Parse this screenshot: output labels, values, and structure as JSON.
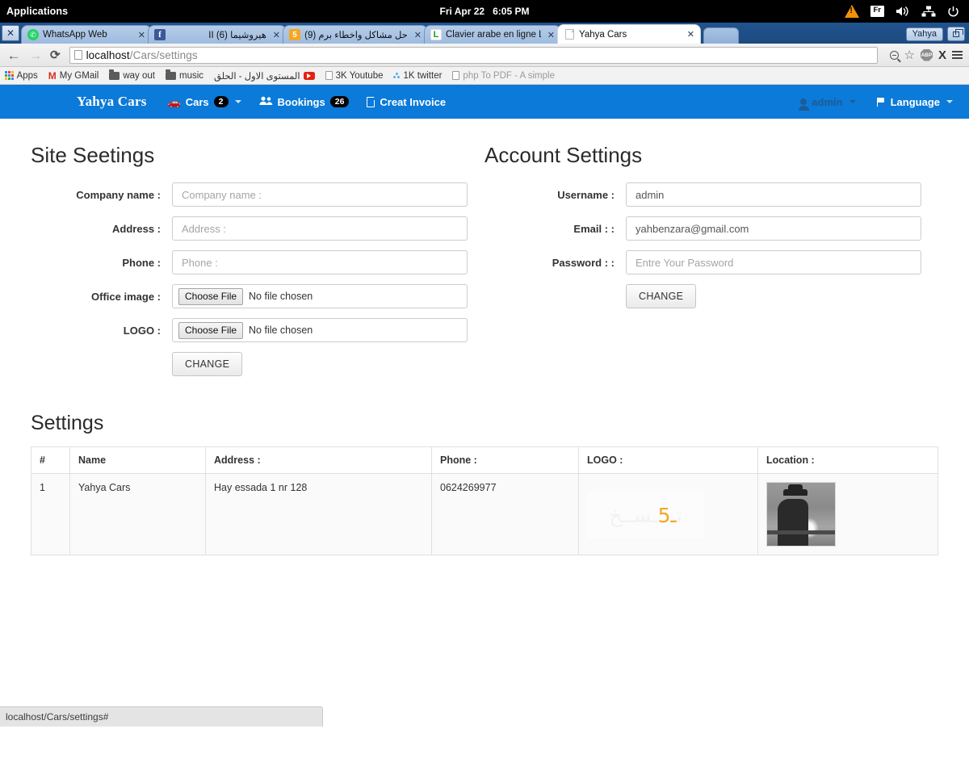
{
  "os": {
    "applications_label": "Applications",
    "clock_date": "Fri Apr 22",
    "clock_time": "6:05 PM",
    "tray": {
      "warning_icon": "warning-triangle-icon",
      "keyboard_layout": "Fr",
      "volume_icon": "speaker-icon",
      "network_icon": "network-icon",
      "power_icon": "power-icon"
    }
  },
  "browser": {
    "tabs": [
      {
        "title": "WhatsApp Web",
        "favicon": "whatsapp-icon",
        "rtl": false,
        "active": false
      },
      {
        "title": "هيروشيما II (6)",
        "favicon": "facebook-icon",
        "rtl": true,
        "active": false
      },
      {
        "title": "حل مشاكل واخطاء برم (9)",
        "favicon": "number-5-icon",
        "rtl": true,
        "active": false
      },
      {
        "title": "Clavier arabe en ligne LEX",
        "favicon": "lexilogos-icon",
        "rtl": false,
        "active": false
      },
      {
        "title": "Yahya Cars",
        "favicon": "page-icon",
        "rtl": false,
        "active": true
      }
    ],
    "window_close_label": "✕",
    "user_pill": "Yahya",
    "toolbar": {
      "back_icon": "back-arrow-icon",
      "forward_icon": "forward-arrow-icon",
      "reload_icon": "reload-icon",
      "url_host": "localhost",
      "url_path": "/Cars/settings",
      "zoom_out_icon": "zoom-out-icon",
      "bookmark_star_icon": "star-icon",
      "adblock_label": "ABP",
      "extension_x_label": "X",
      "menu_icon": "hamburger-menu-icon"
    },
    "bookmarks": [
      {
        "label": "Apps",
        "icon": "apps-grid-icon",
        "faded": false,
        "rtl": false
      },
      {
        "label": "My GMail",
        "icon": "gmail-icon",
        "faded": false,
        "rtl": false
      },
      {
        "label": "way out",
        "icon": "folder-icon",
        "faded": false,
        "rtl": false
      },
      {
        "label": "music",
        "icon": "folder-icon",
        "faded": false,
        "rtl": false
      },
      {
        "label": "المستوى الاول - الحلق",
        "icon": "youtube-icon",
        "faded": false,
        "rtl": true
      },
      {
        "label": "3K Youtube",
        "icon": "page-icon",
        "faded": false,
        "rtl": false
      },
      {
        "label": "1K twitter",
        "icon": "twitter-icon",
        "faded": false,
        "rtl": false
      },
      {
        "label": "php To PDF - A simple",
        "icon": "page-icon",
        "faded": true,
        "rtl": false
      }
    ],
    "status_bar_text": "localhost/Cars/settings#"
  },
  "app": {
    "navbar": {
      "brand": "Yahya Cars",
      "items": [
        {
          "label": "Cars",
          "badge": "2",
          "icon": "car-icon",
          "caret": true
        },
        {
          "label": "Bookings",
          "badge": "26",
          "icon": "users-icon",
          "caret": false
        },
        {
          "label": "Creat Invoice",
          "badge": "",
          "icon": "document-icon",
          "caret": false
        }
      ],
      "right_items": [
        {
          "label": "admin",
          "icon": "person-icon",
          "caret": true
        },
        {
          "label": "Language",
          "icon": "flag-icon",
          "caret": true
        }
      ],
      "background_color": "#0b7ad8"
    },
    "site_settings": {
      "title": "Site Seetings",
      "fields": [
        {
          "label": "Company name :",
          "type": "text",
          "value": "",
          "placeholder": "Company name :"
        },
        {
          "label": "Address :",
          "type": "text",
          "value": "",
          "placeholder": "Address :"
        },
        {
          "label": "Phone :",
          "type": "text",
          "value": "",
          "placeholder": "Phone :"
        },
        {
          "label": "Office image :",
          "type": "file",
          "button": "Choose File",
          "status": "No file chosen"
        },
        {
          "label": "LOGO :",
          "type": "file",
          "button": "Choose File",
          "status": "No file chosen"
        }
      ],
      "submit_label": "CHANGE"
    },
    "account_settings": {
      "title": "Account Settings",
      "fields": [
        {
          "label": "Username :",
          "type": "text",
          "value": "admin",
          "placeholder": ""
        },
        {
          "label": "Email : :",
          "type": "text",
          "value": "yahbenzara@gmail.com",
          "placeholder": ""
        },
        {
          "label": "Password : :",
          "type": "password",
          "value": "",
          "placeholder": "Entre Your Password"
        }
      ],
      "submit_label": "CHANGE"
    },
    "table": {
      "title": "Settings",
      "columns": [
        "#",
        "Name",
        "Address :",
        "Phone :",
        "LOGO :",
        "Location :"
      ],
      "rows": [
        {
          "index": "1",
          "name": "Yahya Cars",
          "address": "Hay essada 1 nr 128",
          "phone": "0624269977",
          "logo_alt": "company-logo-image",
          "location_alt": "location-photo-image"
        }
      ]
    }
  }
}
